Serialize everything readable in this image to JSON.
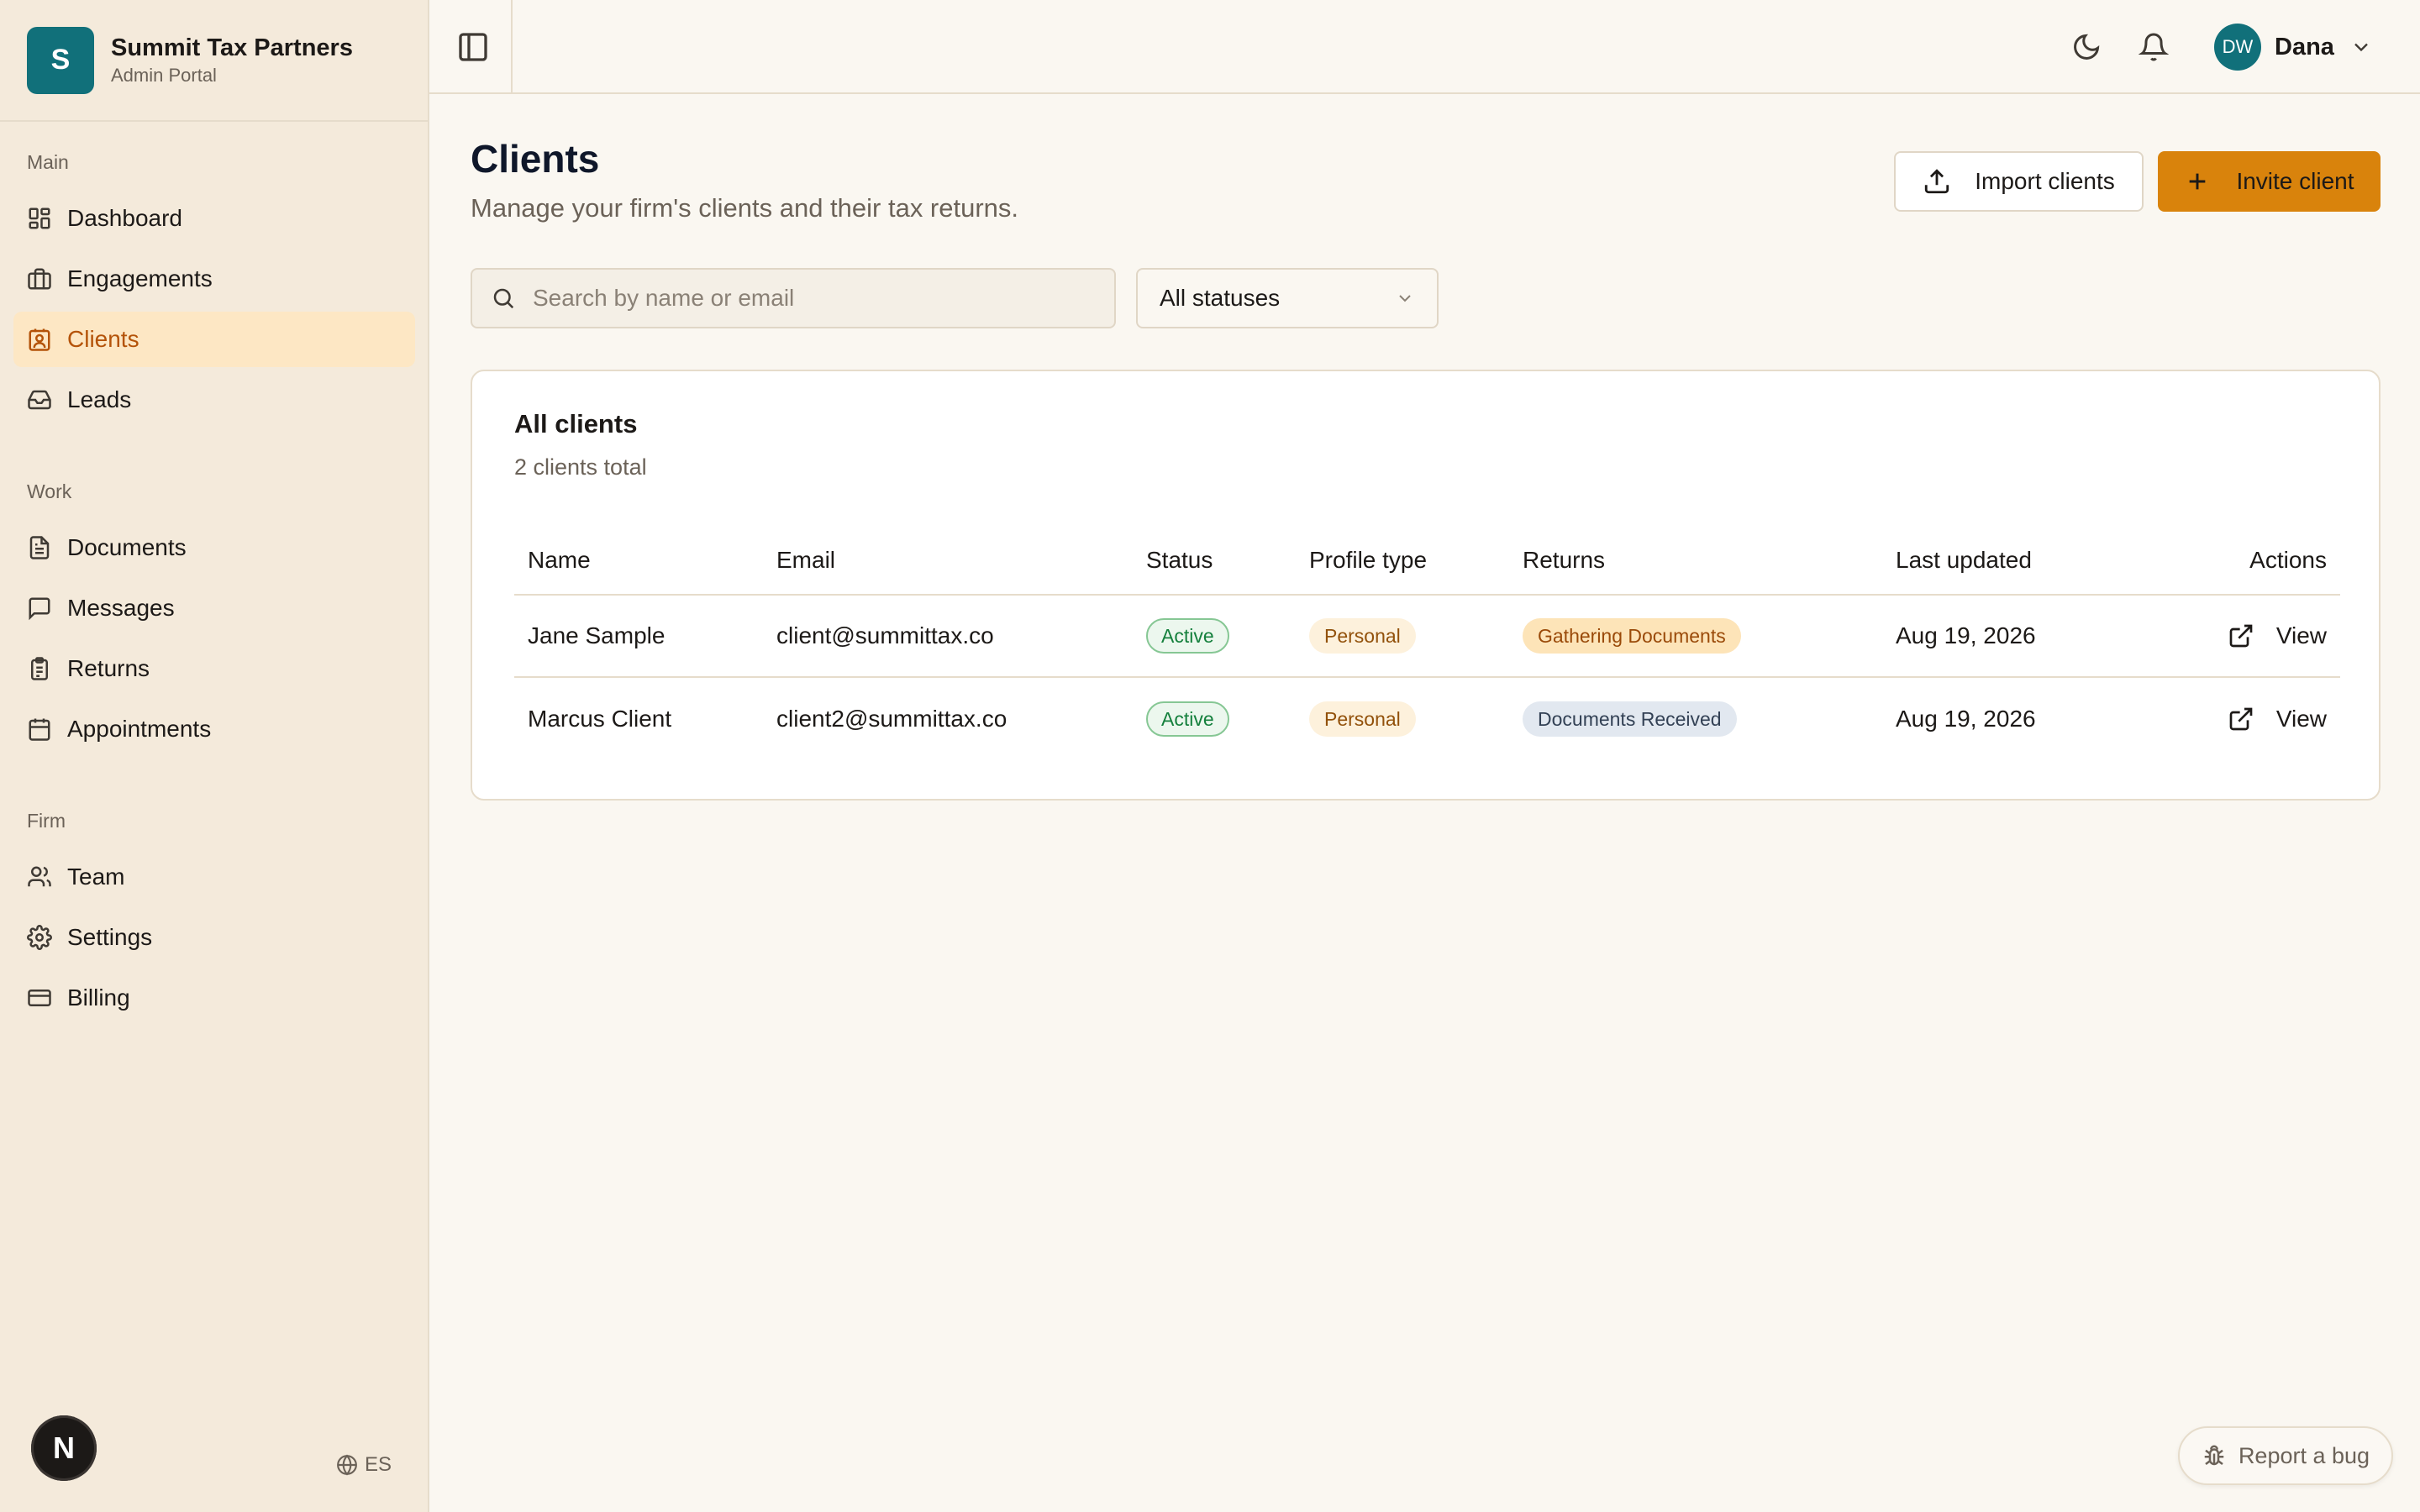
{
  "brand": {
    "logo_letter": "S",
    "name": "Summit Tax Partners",
    "subtitle": "Admin Portal"
  },
  "sidebar": {
    "sections": [
      {
        "heading": "Main",
        "items": [
          {
            "label": "Dashboard",
            "icon": "dashboard-icon"
          },
          {
            "label": "Engagements",
            "icon": "briefcase-icon"
          },
          {
            "label": "Clients",
            "icon": "contact-icon",
            "active": true
          },
          {
            "label": "Leads",
            "icon": "inbox-icon"
          }
        ]
      },
      {
        "heading": "Work",
        "items": [
          {
            "label": "Documents",
            "icon": "document-icon"
          },
          {
            "label": "Messages",
            "icon": "message-icon"
          },
          {
            "label": "Returns",
            "icon": "clipboard-icon"
          },
          {
            "label": "Appointments",
            "icon": "calendar-icon"
          }
        ]
      },
      {
        "heading": "Firm",
        "items": [
          {
            "label": "Team",
            "icon": "users-icon"
          },
          {
            "label": "Settings",
            "icon": "gear-icon"
          },
          {
            "label": "Billing",
            "icon": "credit-card-icon"
          }
        ]
      }
    ],
    "n_badge": "N",
    "language": "ES"
  },
  "topbar": {
    "user_initials": "DW",
    "user_name": "Dana"
  },
  "page": {
    "title": "Clients",
    "subtitle": "Manage your firm's clients and their tax returns.",
    "import_label": "Import clients",
    "invite_label": "Invite client"
  },
  "filters": {
    "search_placeholder": "Search by name or email",
    "search_value": "",
    "status_selected": "All statuses"
  },
  "table": {
    "title": "All clients",
    "count_text": "2 clients total",
    "columns": [
      "Name",
      "Email",
      "Status",
      "Profile type",
      "Returns",
      "Last updated",
      "Actions"
    ],
    "rows": [
      {
        "name": "Jane Sample",
        "email": "client@summittax.co",
        "status": "Active",
        "profile": "Personal",
        "returns": "Gathering Documents",
        "updated": "Aug 19, 2026",
        "action": "View"
      },
      {
        "name": "Marcus Client",
        "email": "client2@summittax.co",
        "status": "Active",
        "profile": "Personal",
        "returns": "Documents Received",
        "updated": "Aug 19, 2026",
        "action": "View"
      }
    ]
  },
  "report_bug_label": "Report a bug",
  "colors": {
    "accent": "#d9830c",
    "brand_teal": "#11707a",
    "sidebar_bg": "#f4eadb",
    "active_nav_bg": "#fde7c4"
  }
}
